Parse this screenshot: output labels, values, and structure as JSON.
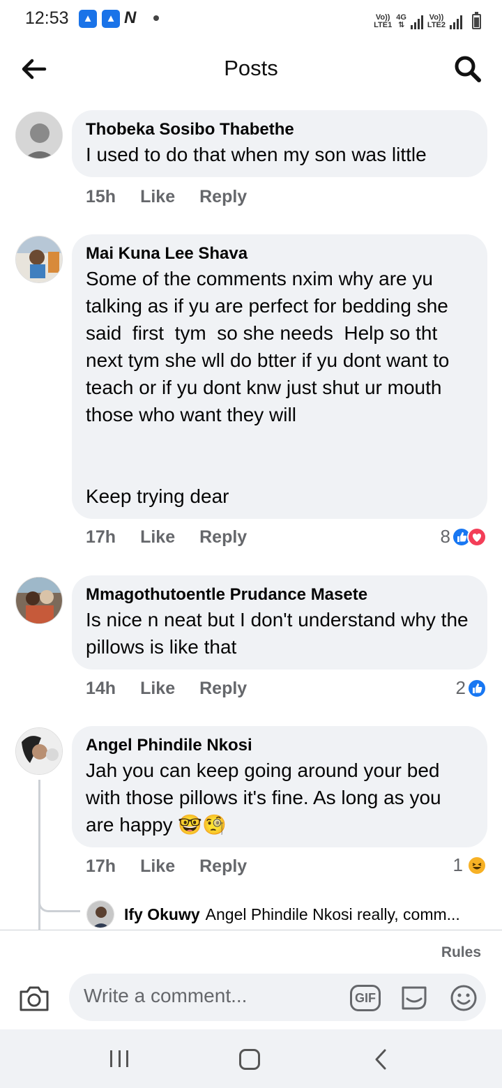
{
  "status_bar": {
    "time": "12:53",
    "app_icons": [
      "rocket-app-icon",
      "rocket-app-icon",
      "n-icon"
    ],
    "net1_top": "Vo))",
    "net1_bottom": "LTE1",
    "net_type": "4G",
    "net2_top": "Vo))",
    "net2_bottom": "LTE2"
  },
  "header": {
    "title": "Posts",
    "back_icon": "arrow-left-icon",
    "search_icon": "search-icon"
  },
  "comments": [
    {
      "author": "Thobeka Sosibo Thabethe",
      "text": "I used to do that when my son was little",
      "time": "15h",
      "like": "Like",
      "reply": "Reply",
      "reaction_count": ""
    },
    {
      "author": "Mai Kuna Lee Shava",
      "text": "Some of the comments nxim why are yu talking as if yu are perfect for bedding she said  first  tym  so she needs  Help so tht next tym she wll do btter if yu dont want to teach or if yu dont knw just shut ur mouth those who want they will\n\n\nKeep trying dear",
      "time": "17h",
      "like": "Like",
      "reply": "Reply",
      "reaction_count": "8",
      "reactions": [
        "like",
        "love"
      ]
    },
    {
      "author": "Mmagothutoentle Prudance Masete",
      "text": "Is nice n neat but I don't understand why the pillows is like that",
      "time": "14h",
      "like": "Like",
      "reply": "Reply",
      "reaction_count": "2",
      "reactions": [
        "like"
      ]
    },
    {
      "author": "Angel Phindile Nkosi",
      "text": "Jah you can keep going around your bed with those pillows it's fine. As long as you are happy 🤓🧐",
      "time": "17h",
      "like": "Like",
      "reply": "Reply",
      "reaction_count": "1",
      "reactions": [
        "haha"
      ]
    }
  ],
  "reply_preview": {
    "author": "Ify Okuwy",
    "text": "Angel Phindile Nkosi really, comm..."
  },
  "composer": {
    "rules": "Rules",
    "placeholder": "Write a comment...",
    "gif_label": "GIF"
  },
  "colors": {
    "bubble": "#f0f2f5",
    "meta": "#65676b",
    "like_blue": "#1877f2",
    "love_red": "#f33e58",
    "haha_yellow": "#f7b125"
  }
}
